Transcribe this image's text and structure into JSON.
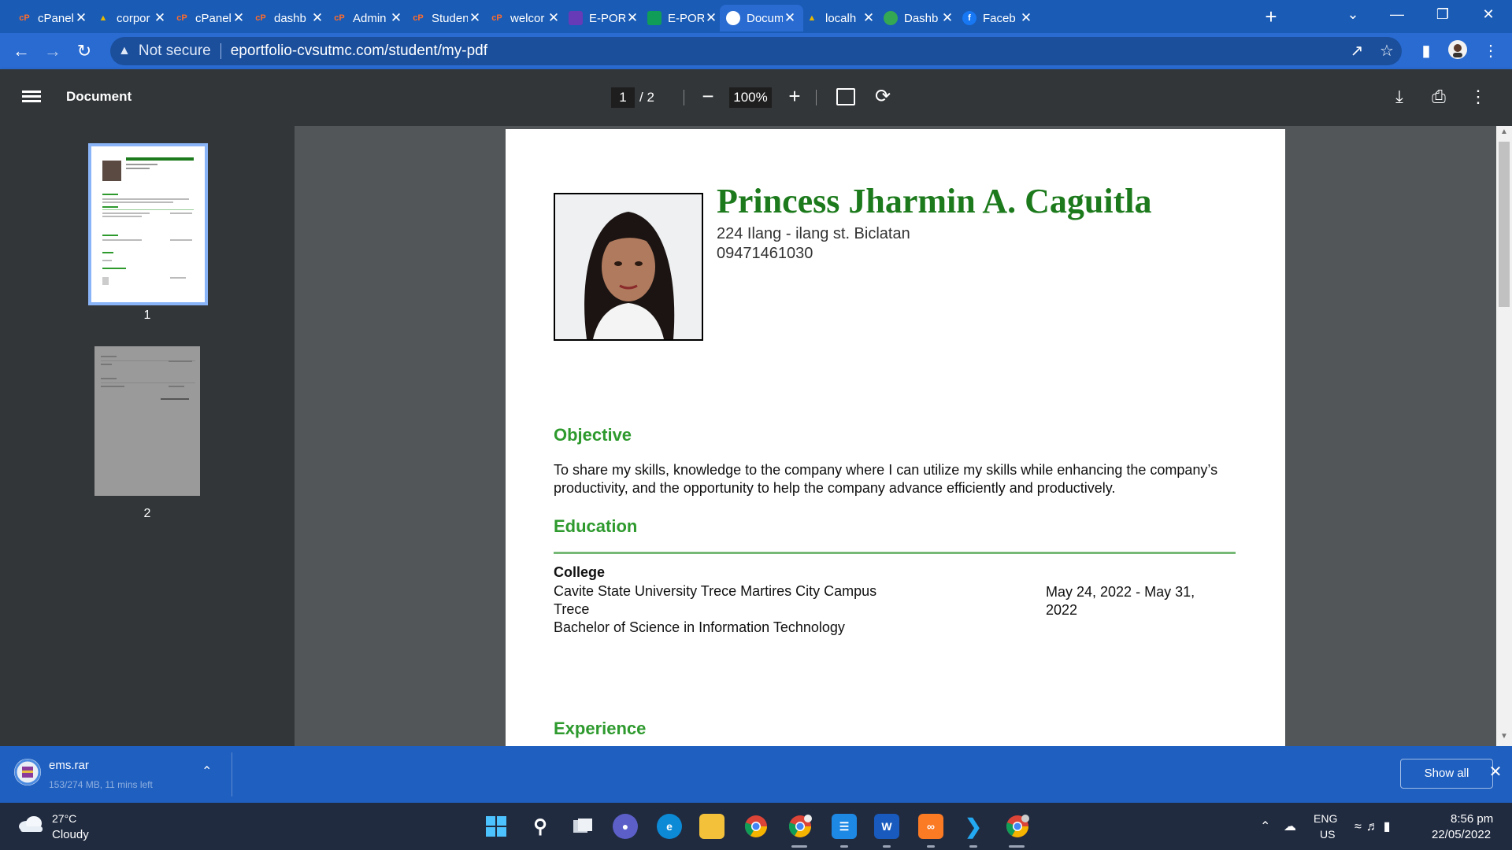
{
  "browser": {
    "tabs": [
      {
        "label": "cPanel",
        "icon": "cpanel-icon",
        "color": "#ff6c2c"
      },
      {
        "label": "corpor",
        "icon": "mountain-logo-icon",
        "color": "#e6b800"
      },
      {
        "label": "cPanel",
        "icon": "cpanel-icon",
        "color": "#ff6c2c"
      },
      {
        "label": "dashb",
        "icon": "cpanel-icon",
        "color": "#ff6c2c"
      },
      {
        "label": "Admin",
        "icon": "cpanel-icon",
        "color": "#ff6c2c"
      },
      {
        "label": "Studen",
        "icon": "cpanel-icon",
        "color": "#ff6c2c"
      },
      {
        "label": "welcor",
        "icon": "cpanel-icon",
        "color": "#ff6c2c"
      },
      {
        "label": "E-POR",
        "icon": "forms-icon",
        "color": "#673ab7"
      },
      {
        "label": "E-POR",
        "icon": "sheets-icon",
        "color": "#0f9d58"
      },
      {
        "label": "Docum",
        "icon": "globe-icon",
        "color": "#ffffff"
      },
      {
        "label": "localh",
        "icon": "mountain-logo-icon",
        "color": "#e6b800"
      },
      {
        "label": "Dashb",
        "icon": "leaf-icon",
        "color": "#34a853"
      },
      {
        "label": "Faceb",
        "icon": "facebook-icon",
        "color": "#1877f2"
      }
    ],
    "active_tab_index": 9,
    "new_tab_label": "+",
    "address": {
      "security_label": "Not secure",
      "url": "eportfolio-cvsutmc.com/student/my-pdf"
    }
  },
  "pdf_toolbar": {
    "title": "Document",
    "current_page": "1",
    "page_total": "/  2",
    "zoom": "100%"
  },
  "sidebar": {
    "thumb1_label": "1",
    "thumb2_label": "2"
  },
  "resume": {
    "name": "Princess Jharmin A. Caguitla",
    "address": "224 Ilang - ilang st. Biclatan",
    "phone": "09471461030",
    "objective_heading": "Objective",
    "objective_text": "To share my skills, knowledge to the company where I can utilize my skills while enhancing the company’s productivity, and the opportunity to help the company advance efficiently and productively.",
    "education_heading": "Education",
    "education": {
      "level": "College",
      "school_line1": "Cavite State University Trece Martires City Campus",
      "school_line2": "Trece",
      "degree": "Bachelor of Science in Information Technology",
      "dates": "May 24, 2022 - May 31, 2022"
    },
    "experience_heading": "Experience",
    "colors": {
      "name": "#1c7a1c",
      "heading": "#2e9a2e",
      "rule": "#76b876"
    }
  },
  "download": {
    "filename": "ems.rar",
    "status": "153/274 MB, 11 mins left",
    "show_all_label": "Show all"
  },
  "taskbar": {
    "temperature": "27°C",
    "condition": "Cloudy",
    "lang_line1": "ENG",
    "lang_line2": "US",
    "time": "8:56 pm",
    "date": "22/05/2022"
  }
}
